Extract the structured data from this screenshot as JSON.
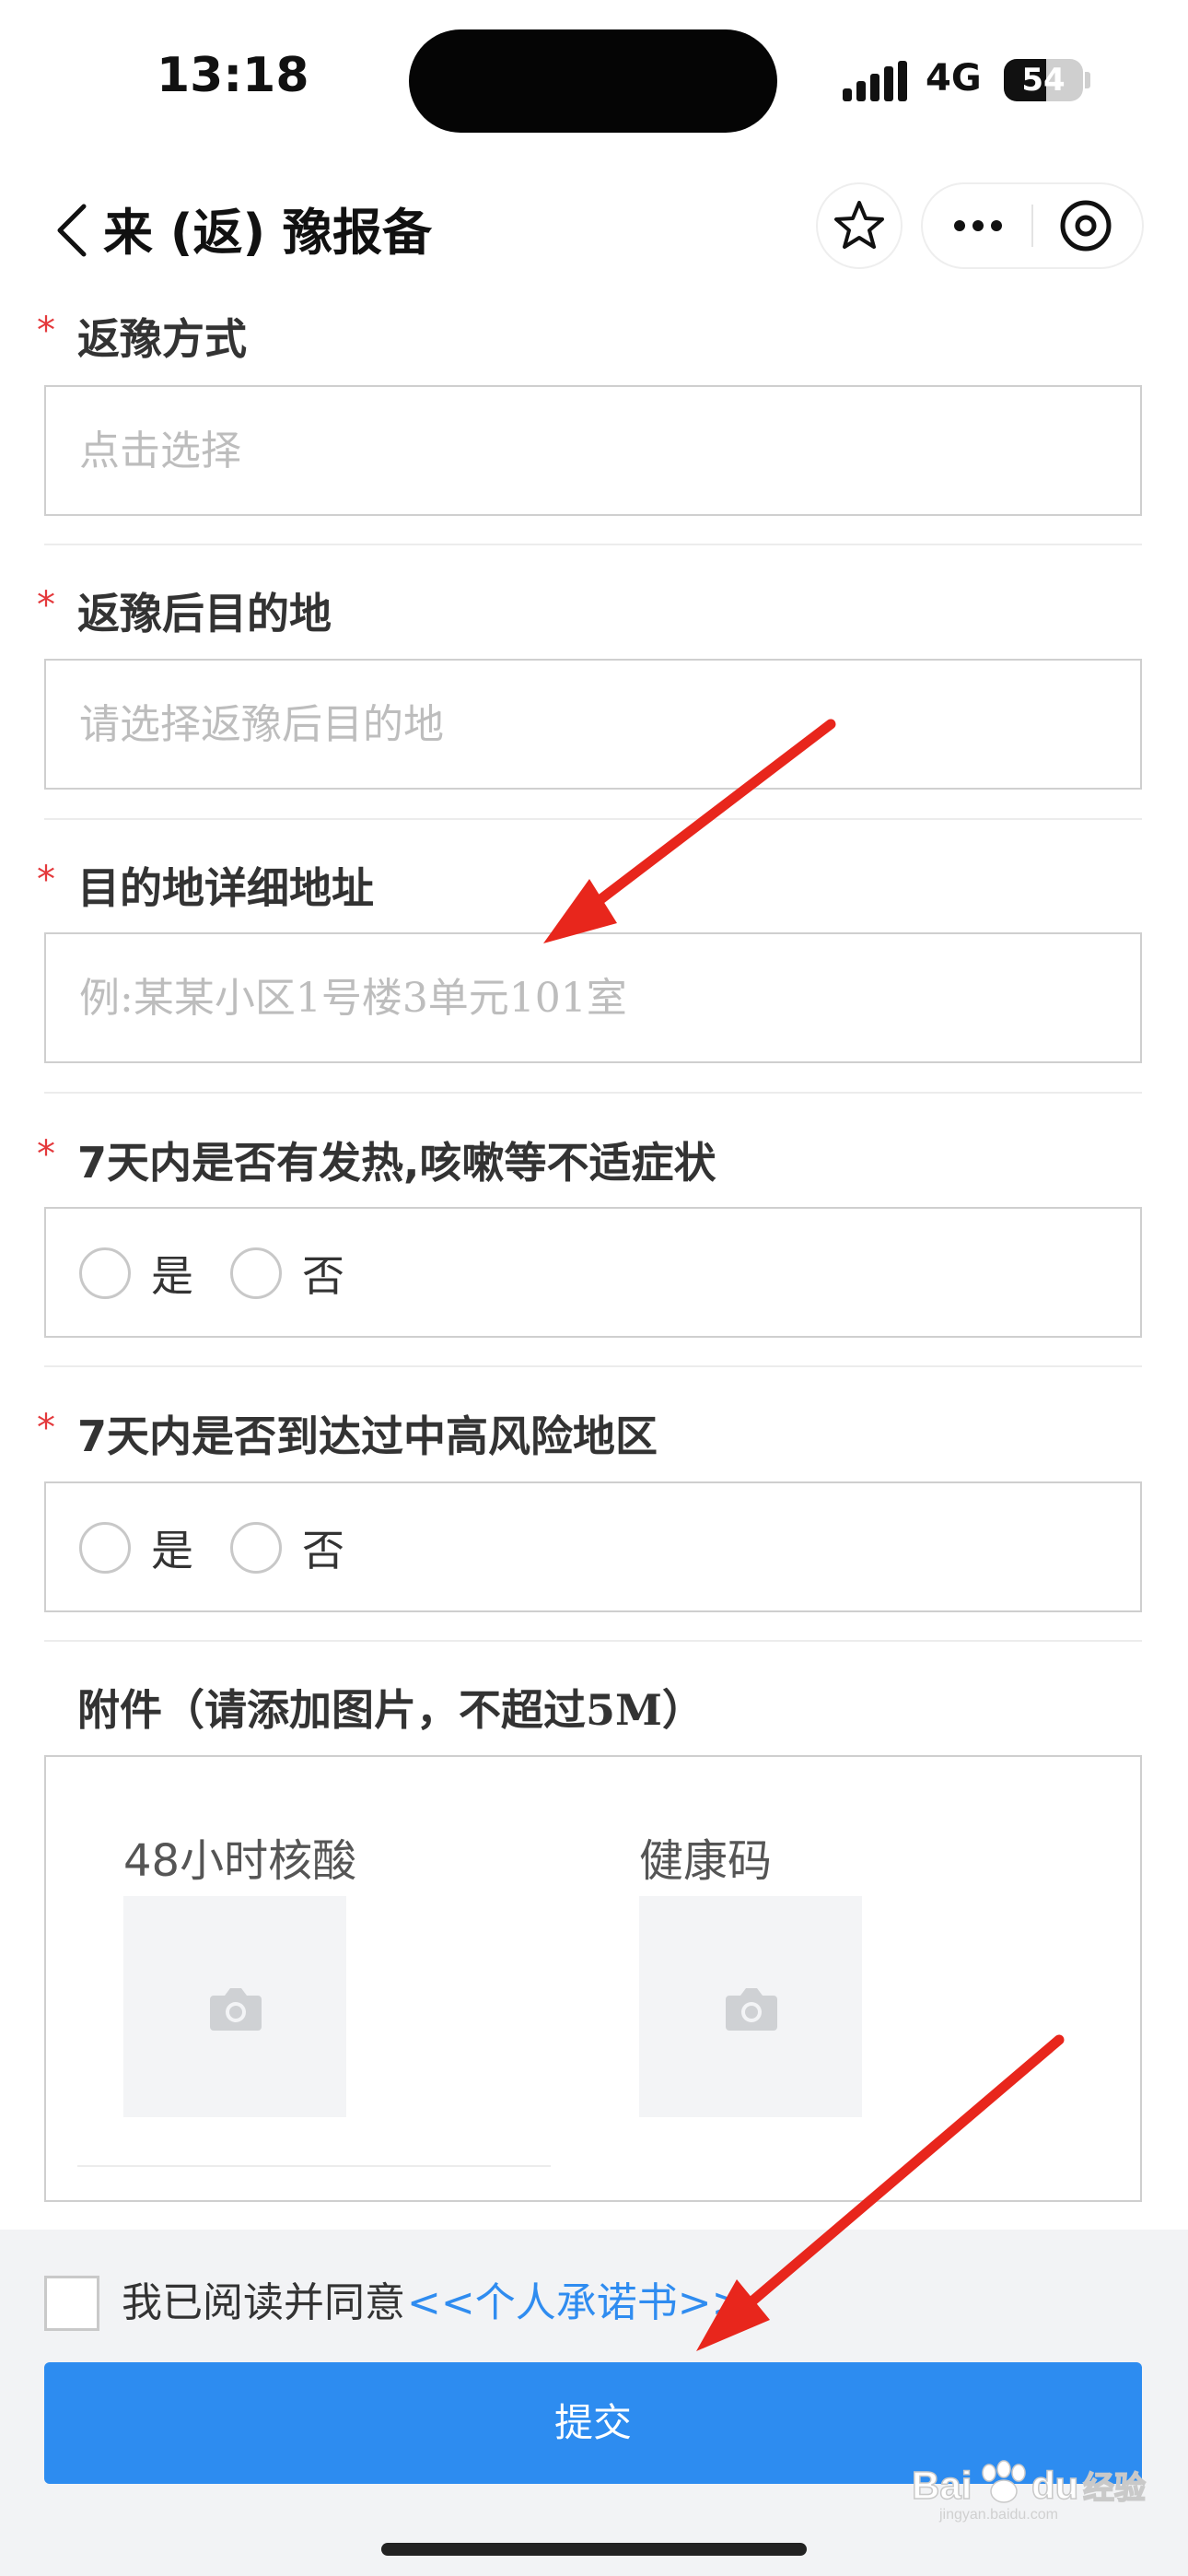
{
  "status_bar": {
    "time": "13:18",
    "network": "4G",
    "battery_level": "54",
    "battery_fraction": 0.54
  },
  "nav": {
    "title": "来 (返) 豫报备"
  },
  "form": {
    "return_method": {
      "required_mark": "*",
      "label": "返豫方式",
      "placeholder": "点击选择"
    },
    "destination": {
      "required_mark": "*",
      "label": "返豫后目的地",
      "placeholder": "请选择返豫后目的地"
    },
    "address": {
      "required_mark": "*",
      "label": "目的地详细地址",
      "placeholder": "例:某某小区1号楼3单元101室"
    },
    "symptoms": {
      "required_mark": "*",
      "label": "7天内是否有发热,咳嗽等不适症状",
      "options": [
        "是",
        "否"
      ]
    },
    "risk_area": {
      "required_mark": "*",
      "label": "7天内是否到达过中高风险地区",
      "options": [
        "是",
        "否"
      ]
    },
    "attachments": {
      "label": "附件（请添加图片，不超过5M）",
      "items": [
        {
          "title": "48小时核酸",
          "icon": "camera-icon"
        },
        {
          "title": "健康码",
          "icon": "camera-icon"
        }
      ]
    }
  },
  "footer": {
    "agree_text": "我已阅读并同意",
    "agree_link": "<<个人承诺书>>",
    "submit_label": "提交"
  },
  "watermark": {
    "text": "Baidu经验",
    "sub": "jingyan.baidu.com"
  },
  "colors": {
    "accent": "#2d8cf0",
    "required": "#e4393c",
    "arrow": "#e8261c"
  }
}
